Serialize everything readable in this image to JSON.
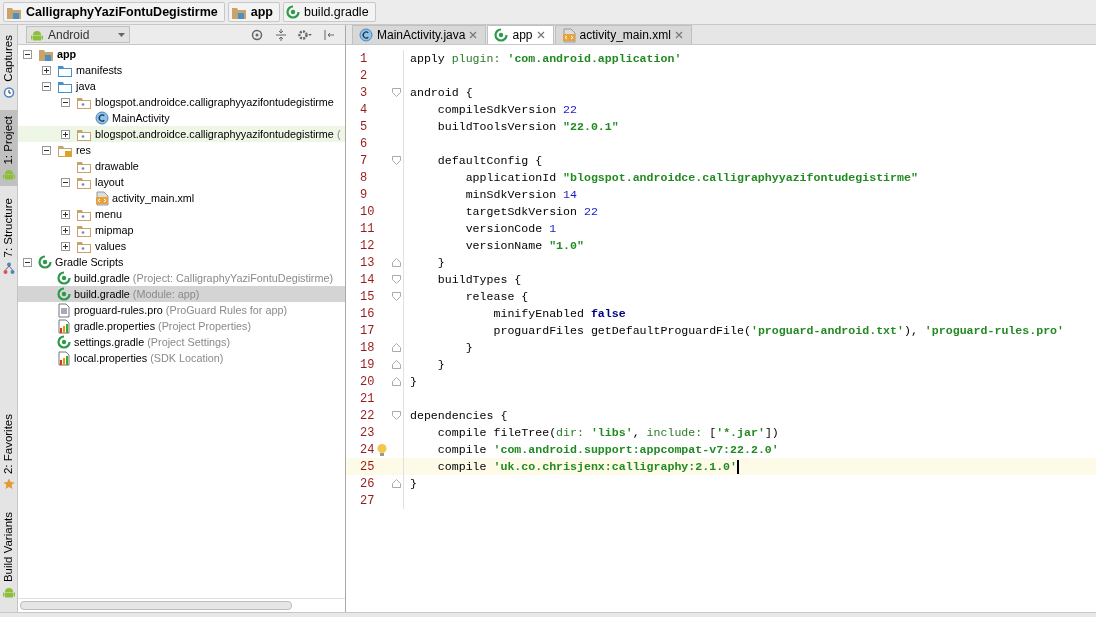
{
  "breadcrumbs": [
    {
      "label": "CalligraphyYaziFontuDegistirme",
      "kind": "module"
    },
    {
      "label": "app",
      "kind": "module"
    },
    {
      "label": "build.gradle",
      "kind": "gradle"
    }
  ],
  "tool_strip": {
    "top": [
      {
        "label": "Captures",
        "kind": "clock",
        "selected": false
      },
      {
        "label": "1: Project",
        "kind": "android",
        "selected": true
      },
      {
        "label": "7: Structure",
        "kind": "structure",
        "selected": false
      }
    ],
    "bottom": [
      {
        "label": "2: Favorites",
        "kind": "star",
        "selected": false
      },
      {
        "label": "Build Variants",
        "kind": "android",
        "selected": false
      }
    ]
  },
  "project_panel": {
    "view": "Android",
    "tree": [
      {
        "label": "app",
        "kind": "module",
        "expanded": true,
        "children": [
          {
            "label": "manifests",
            "kind": "folder",
            "expanded": false
          },
          {
            "label": "java",
            "kind": "folder",
            "expanded": true,
            "children": [
              {
                "label": "blogspot.androidce.calligraphyyazifontudegistirme",
                "kind": "package",
                "expanded": true,
                "children": [
                  {
                    "label": "MainActivity",
                    "kind": "class"
                  }
                ]
              },
              {
                "label": "blogspot.androidce.calligraphyyazifontudegistirme",
                "note": "(",
                "kind": "package",
                "expanded": false,
                "tinted": true
              }
            ]
          },
          {
            "label": "res",
            "kind": "res",
            "expanded": true,
            "children": [
              {
                "label": "drawable",
                "kind": "package"
              },
              {
                "label": "layout",
                "kind": "package",
                "expanded": true,
                "children": [
                  {
                    "label": "activity_main.xml",
                    "kind": "xml"
                  }
                ]
              },
              {
                "label": "menu",
                "kind": "package",
                "expanded": false
              },
              {
                "label": "mipmap",
                "kind": "package",
                "expanded": false
              },
              {
                "label": "values",
                "kind": "package",
                "expanded": false
              }
            ]
          }
        ]
      },
      {
        "label": "Gradle Scripts",
        "kind": "gradle",
        "expanded": true,
        "children": [
          {
            "label": "build.gradle",
            "note": "(Project: CalligraphyYaziFontuDegistirme)",
            "kind": "gradle",
            "selected": false
          },
          {
            "label": "build.gradle",
            "note": "(Module: app)",
            "kind": "gradle",
            "selected": true
          },
          {
            "label": "proguard-rules.pro",
            "note": "(ProGuard Rules for app)",
            "kind": "text",
            "selected": false
          },
          {
            "label": "gradle.properties",
            "note": "(Project Properties)",
            "kind": "properties",
            "selected": false
          },
          {
            "label": "settings.gradle",
            "note": "(Project Settings)",
            "kind": "gradle",
            "selected": false
          },
          {
            "label": "local.properties",
            "note": "(SDK Location)",
            "kind": "properties",
            "selected": false
          }
        ]
      }
    ]
  },
  "editor": {
    "tabs": [
      {
        "label": "MainActivity.java",
        "kind": "class",
        "selected": false
      },
      {
        "label": "app",
        "kind": "gradle",
        "selected": true
      },
      {
        "label": "activity_main.xml",
        "kind": "xml",
        "selected": false
      }
    ],
    "lines": [
      {
        "number": "1",
        "kind": "plain",
        "tokens": [
          {
            "kind": "plain",
            "text": "apply "
          },
          {
            "kind": "named",
            "text": "plugin: "
          },
          {
            "kind": "string",
            "text": "'com.android.application'"
          }
        ]
      },
      {
        "number": "2",
        "kind": "plain"
      },
      {
        "number": "3",
        "kind": "fold-start",
        "tokens": [
          {
            "kind": "plain",
            "text": "android {"
          }
        ]
      },
      {
        "number": "4",
        "kind": "plain",
        "tokens": [
          {
            "kind": "plain",
            "text": "    compileSdkVersion "
          },
          {
            "kind": "number",
            "text": "22"
          }
        ]
      },
      {
        "number": "5",
        "kind": "plain",
        "tokens": [
          {
            "kind": "plain",
            "text": "    buildToolsVersion "
          },
          {
            "kind": "string",
            "text": "\"22.0.1\""
          }
        ]
      },
      {
        "number": "6",
        "kind": "plain"
      },
      {
        "number": "7",
        "kind": "fold-start",
        "tokens": [
          {
            "kind": "plain",
            "text": "    defaultConfig {"
          }
        ]
      },
      {
        "number": "8",
        "kind": "plain",
        "tokens": [
          {
            "kind": "plain",
            "text": "        applicationId "
          },
          {
            "kind": "string",
            "text": "\"blogspot.androidce.calligraphyyazifontudegistirme\""
          }
        ]
      },
      {
        "number": "9",
        "kind": "plain",
        "tokens": [
          {
            "kind": "plain",
            "text": "        minSdkVersion "
          },
          {
            "kind": "number",
            "text": "14"
          }
        ]
      },
      {
        "number": "10",
        "kind": "plain",
        "tokens": [
          {
            "kind": "plain",
            "text": "        targetSdkVersion "
          },
          {
            "kind": "number",
            "text": "22"
          }
        ]
      },
      {
        "number": "11",
        "kind": "plain",
        "tokens": [
          {
            "kind": "plain",
            "text": "        versionCode "
          },
          {
            "kind": "number",
            "text": "1"
          }
        ]
      },
      {
        "number": "12",
        "kind": "plain",
        "tokens": [
          {
            "kind": "plain",
            "text": "        versionName "
          },
          {
            "kind": "string",
            "text": "\"1.0\""
          }
        ]
      },
      {
        "number": "13",
        "kind": "fold-end",
        "tokens": [
          {
            "kind": "plain",
            "text": "    }"
          }
        ]
      },
      {
        "number": "14",
        "kind": "fold-start",
        "tokens": [
          {
            "kind": "plain",
            "text": "    buildTypes {"
          }
        ]
      },
      {
        "number": "15",
        "kind": "fold-start",
        "tokens": [
          {
            "kind": "plain",
            "text": "        release {"
          }
        ]
      },
      {
        "number": "16",
        "kind": "plain",
        "tokens": [
          {
            "kind": "plain",
            "text": "            minifyEnabled "
          },
          {
            "kind": "keyword",
            "text": "false"
          }
        ]
      },
      {
        "number": "17",
        "kind": "plain",
        "tokens": [
          {
            "kind": "plain",
            "text": "            proguardFiles getDefaultProguardFile("
          },
          {
            "kind": "string",
            "text": "'proguard-android.txt'"
          },
          {
            "kind": "plain",
            "text": "), "
          },
          {
            "kind": "string",
            "text": "'proguard-rules.pro'"
          }
        ]
      },
      {
        "number": "18",
        "kind": "fold-end",
        "tokens": [
          {
            "kind": "plain",
            "text": "        }"
          }
        ]
      },
      {
        "number": "19",
        "kind": "fold-end",
        "tokens": [
          {
            "kind": "plain",
            "text": "    }"
          }
        ]
      },
      {
        "number": "20",
        "kind": "fold-end",
        "tokens": [
          {
            "kind": "plain",
            "text": "}"
          }
        ]
      },
      {
        "number": "21",
        "kind": "plain"
      },
      {
        "number": "22",
        "kind": "fold-start",
        "tokens": [
          {
            "kind": "plain",
            "text": "dependencies {"
          }
        ]
      },
      {
        "number": "23",
        "kind": "plain",
        "tokens": [
          {
            "kind": "plain",
            "text": "    compile fileTree("
          },
          {
            "kind": "named",
            "text": "dir: "
          },
          {
            "kind": "string",
            "text": "'libs'"
          },
          {
            "kind": "plain",
            "text": ", "
          },
          {
            "kind": "named",
            "text": "include: "
          },
          {
            "kind": "plain",
            "text": "["
          },
          {
            "kind": "string",
            "text": "'*.jar'"
          },
          {
            "kind": "plain",
            "text": "])"
          }
        ]
      },
      {
        "number": "24",
        "kind": "plain",
        "bulb": true,
        "tokens": [
          {
            "kind": "plain",
            "text": "    compile "
          },
          {
            "kind": "string",
            "text": "'com.android.support:appcompat-v7:22.2.0'"
          }
        ]
      },
      {
        "number": "25",
        "kind": "plain",
        "current": true,
        "tokens": [
          {
            "kind": "plain",
            "text": "    compile "
          },
          {
            "kind": "string",
            "text": "'uk.co.chrisjenx:calligraphy:2.1.0'"
          }
        ]
      },
      {
        "number": "26",
        "kind": "fold-end",
        "tokens": [
          {
            "kind": "plain",
            "text": "}"
          }
        ]
      },
      {
        "number": "27",
        "kind": "plain"
      }
    ]
  }
}
